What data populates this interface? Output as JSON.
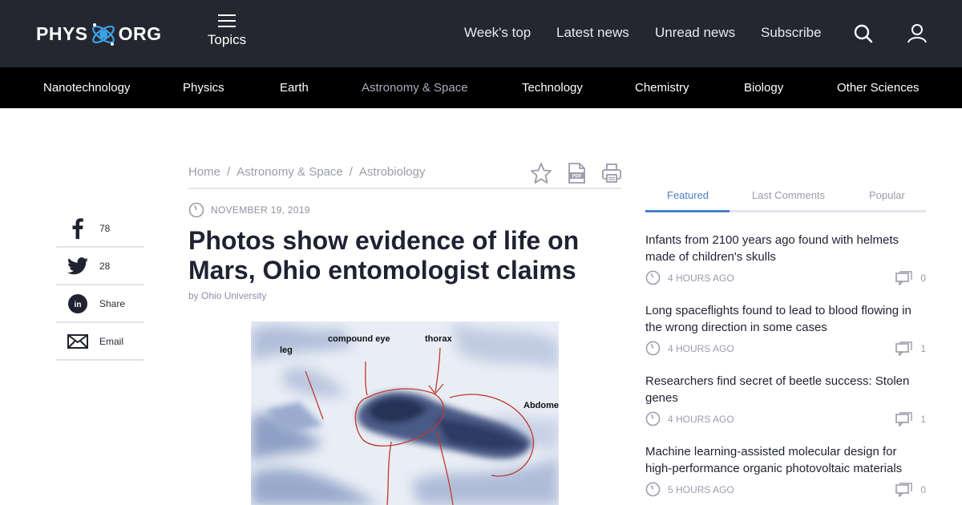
{
  "logo": {
    "left": "PHYS",
    "right": "ORG"
  },
  "topics": {
    "label": "Topics"
  },
  "nav": [
    "Week's top",
    "Latest news",
    "Unread news",
    "Subscribe"
  ],
  "categories": [
    {
      "label": "Nanotechnology",
      "active": false
    },
    {
      "label": "Physics",
      "active": false
    },
    {
      "label": "Earth",
      "active": false
    },
    {
      "label": "Astronomy & Space",
      "active": true
    },
    {
      "label": "Technology",
      "active": false
    },
    {
      "label": "Chemistry",
      "active": false
    },
    {
      "label": "Biology",
      "active": false
    },
    {
      "label": "Other Sciences",
      "active": false
    }
  ],
  "share": [
    {
      "icon": "facebook-icon",
      "label": "78"
    },
    {
      "icon": "twitter-icon",
      "label": "28"
    },
    {
      "icon": "linkedin-icon",
      "label": "Share"
    },
    {
      "icon": "email-icon",
      "label": "Email"
    }
  ],
  "breadcrumb": [
    "Home",
    "Astronomy & Space",
    "Astrobiology"
  ],
  "breadcrumb_separator": "/",
  "article": {
    "date": "NOVEMBER 19, 2019",
    "title": "Photos show evidence of life on Mars, Ohio entomologist claims",
    "byline": "by Ohio University",
    "image_labels": {
      "leg": "leg",
      "compound_eye": "compound eye",
      "thorax": "thorax",
      "abdomen": "Abdomen"
    }
  },
  "sidebar": {
    "tabs": [
      {
        "label": "Featured",
        "active": true
      },
      {
        "label": "Last Comments",
        "active": false
      },
      {
        "label": "Popular",
        "active": false
      }
    ],
    "items": [
      {
        "headline": "Infants from 2100 years ago found with helmets made of children's skulls",
        "time": "4 HOURS AGO",
        "comments": "0"
      },
      {
        "headline": "Long spaceflights found to lead to blood flowing in the wrong direction in some cases",
        "time": "4 HOURS AGO",
        "comments": "1"
      },
      {
        "headline": "Researchers find secret of beetle success: Stolen genes",
        "time": "4 HOURS AGO",
        "comments": "1"
      },
      {
        "headline": "Machine learning-assisted molecular design for high-performance organic photovoltaic materials",
        "time": "5 HOURS AGO",
        "comments": "0"
      }
    ]
  },
  "colors": {
    "topbar": "#24272f",
    "category_bar": "#000000",
    "accent": "#4a7fc7",
    "muted": "#9a9dab"
  }
}
